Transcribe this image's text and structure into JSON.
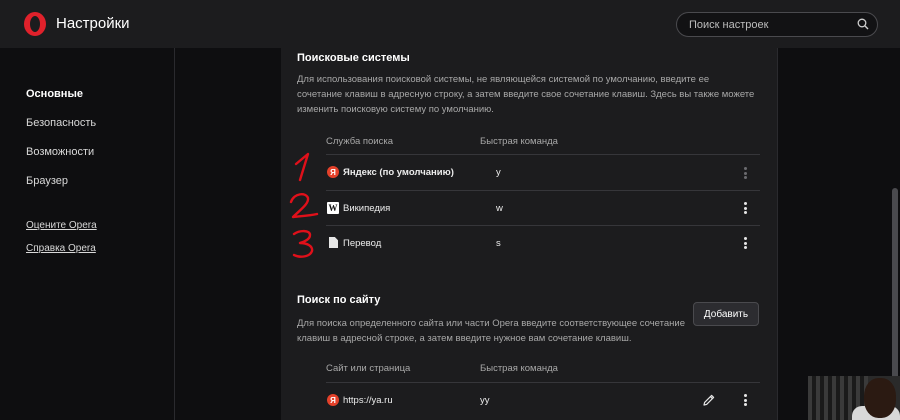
{
  "app": {
    "title": "Настройки",
    "logo_icon": "opera-logo-icon"
  },
  "search": {
    "placeholder": "Поиск настроек"
  },
  "sidebar": {
    "items": [
      {
        "label": "Основные",
        "active": true
      },
      {
        "label": "Безопасность",
        "active": false
      },
      {
        "label": "Возможности",
        "active": false
      },
      {
        "label": "Браузер",
        "active": false
      }
    ],
    "links": [
      {
        "label": "Оцените Opera"
      },
      {
        "label": "Справка Opera"
      }
    ]
  },
  "search_engines": {
    "title": "Поисковые системы",
    "description": "Для использования поисковой системы, не являющейся системой по умолчанию, введите ее сочетание клавиш в адресную строку, а затем введите свое сочетание клавиш. Здесь вы также можете изменить поисковую систему по умолчанию.",
    "col_service": "Служба поиска",
    "col_command": "Быстрая команда",
    "rows": [
      {
        "icon": "yandex-icon",
        "name": "Яндекс (по умолчанию)",
        "command": "y"
      },
      {
        "icon": "wikipedia-icon",
        "name": "Википедия",
        "command": "w"
      },
      {
        "icon": "document-icon",
        "name": "Перевод",
        "command": "s"
      }
    ]
  },
  "site_search": {
    "title": "Поиск по сайту",
    "description": "Для поиска определенного сайта или части Opera введите соответствующее сочетание клавиш в адресной строке, а затем введите нужное вам сочетание клавиш.",
    "add_label": "Добавить",
    "col_site": "Сайт или страница",
    "col_command": "Быстрая команда",
    "rows": [
      {
        "icon": "yandex-icon",
        "site": "https://ya.ru",
        "command": "yy"
      }
    ]
  },
  "annotations": {
    "marks": [
      "1",
      "2",
      "3"
    ],
    "color": "#e0101a"
  },
  "colors": {
    "accent": "#e0212b",
    "panel": "#1c1c1e",
    "background": "#0e0e10"
  }
}
